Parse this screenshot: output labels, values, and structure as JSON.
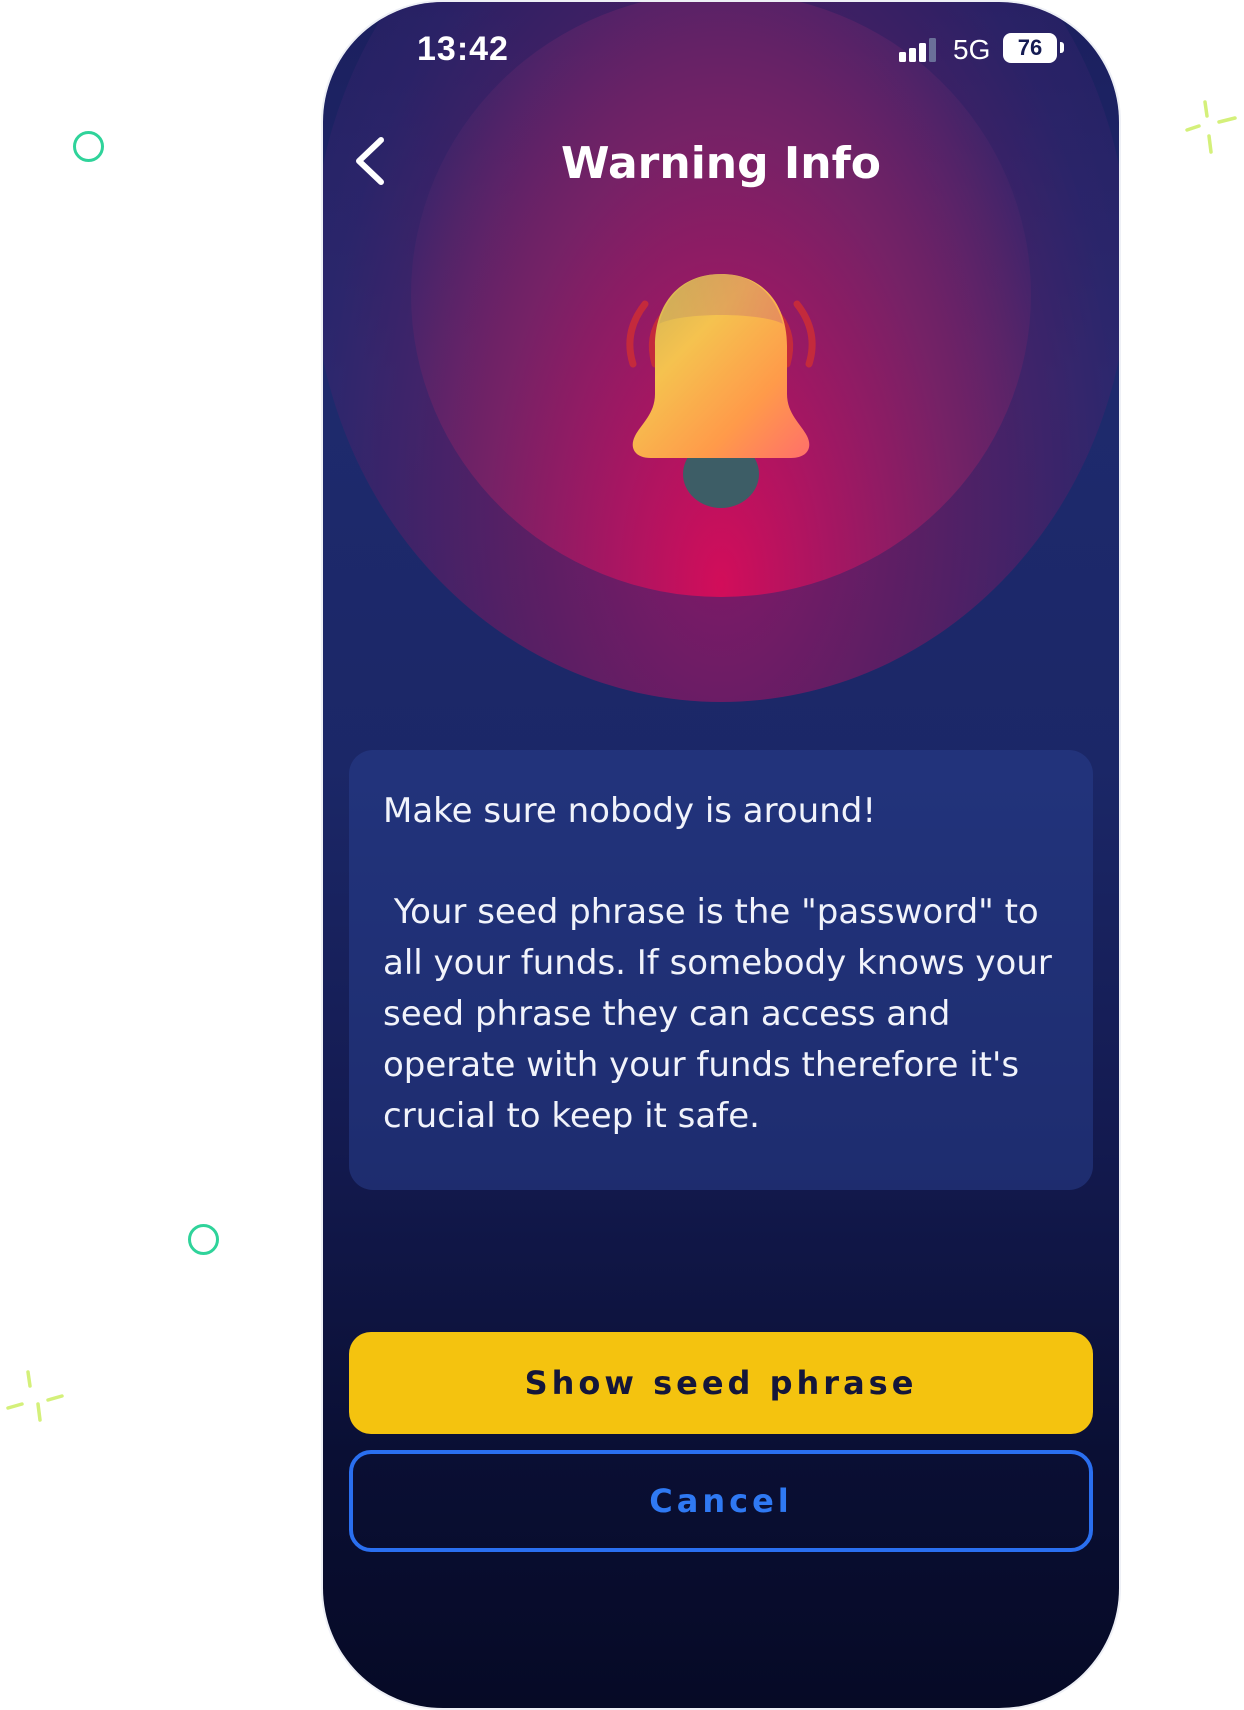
{
  "status_bar": {
    "time": "13:42",
    "network": "5G",
    "battery": "76"
  },
  "header": {
    "title": "Warning Info",
    "back_icon": "chevron-left-icon"
  },
  "illustration": {
    "icon": "ringing-bell-icon"
  },
  "info_card": {
    "heading": "Make sure nobody is around!",
    "body": " Your seed phrase is the \"password\" to all your funds. If somebody knows your seed phrase they can access and operate with your funds therefore it's crucial to keep it safe."
  },
  "actions": {
    "primary_label": "Show seed phrase",
    "secondary_label": "Cancel"
  },
  "colors": {
    "primary_button": "#f4c30f",
    "secondary_border": "#2a6ff0",
    "background_top": "#1b1f5e",
    "glow": "#d20d5a",
    "decor_circle": "#2fd39a",
    "decor_sparkle": "#d4f07a"
  }
}
